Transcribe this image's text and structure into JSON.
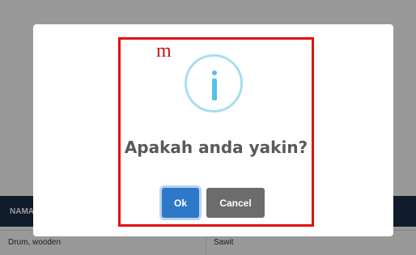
{
  "background": {
    "table_header": "NAMA",
    "row": {
      "col1": "Drum, wooden",
      "col2": "Sawit"
    }
  },
  "annotation": {
    "mark": "m",
    "highlight_color": "#e01010"
  },
  "dialog": {
    "icon": "info-icon",
    "title": "Apakah anda yakin?",
    "ok_label": "Ok",
    "cancel_label": "Cancel",
    "ok_color": "#2e79c7",
    "cancel_color": "#6c6c6c"
  }
}
